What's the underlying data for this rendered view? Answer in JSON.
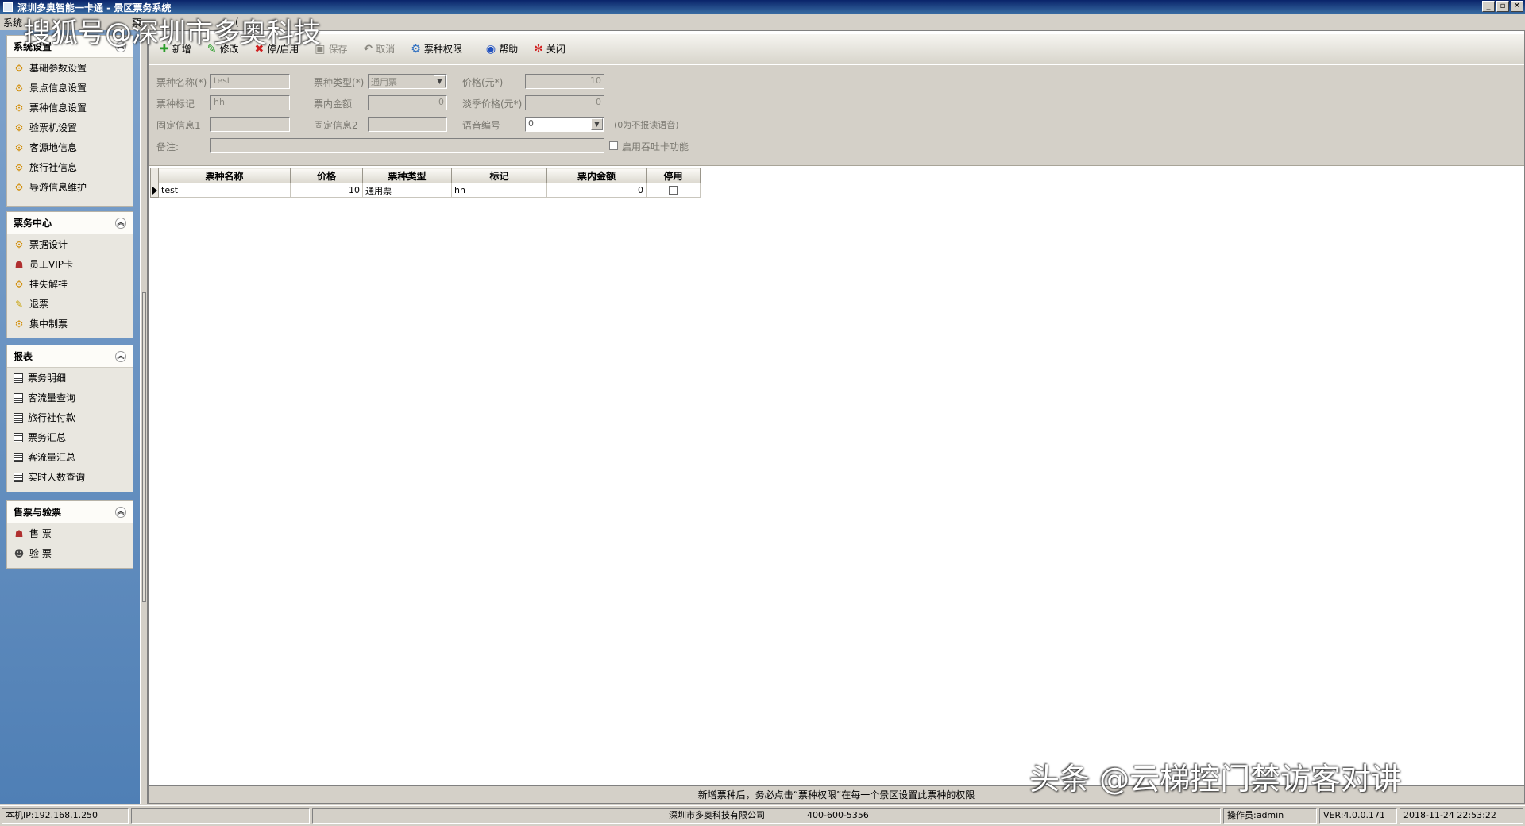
{
  "window": {
    "title": "深圳多奥智能一卡通 - 景区票务系统",
    "buttons": [
      "_",
      "▫",
      "✕"
    ]
  },
  "watermarks": {
    "top": "搜狐号@深圳市多奥科技",
    "bottom": "头条 @云梯控门禁访客对讲"
  },
  "menu": {
    "items": [
      "系统",
      "",
      "票",
      "",
      "(",
      ""
    ]
  },
  "sidebar": {
    "sections": [
      {
        "title": "系统设置",
        "items": [
          "基础参数设置",
          "景点信息设置",
          "票种信息设置",
          "验票机设置",
          "客源地信息",
          "旅行社信息",
          "导游信息维护"
        ]
      },
      {
        "title": "票务中心",
        "items": [
          "票据设计",
          "员工VIP卡",
          "挂失解挂",
          "退票",
          "集中制票"
        ]
      },
      {
        "title": "报表",
        "items": [
          "票务明细",
          "客流量查询",
          "旅行社付款",
          "票务汇总",
          "客流量汇总",
          "实时人数查询"
        ]
      },
      {
        "title": "售票与验票",
        "items": [
          "售 票",
          "验 票"
        ]
      }
    ]
  },
  "toolbar": {
    "add": "新增",
    "edit": "修改",
    "stop_enable": "停/启用",
    "save": "保存",
    "cancel": "取消",
    "permission": "票种权限",
    "help": "帮助",
    "close": "关闭"
  },
  "form": {
    "ticket_name_label": "票种名称(*)",
    "ticket_name_value": "test",
    "ticket_type_label": "票种类型(*)",
    "ticket_type_value": "通用票",
    "price_label": "价格(元*)",
    "price_value": "10",
    "ticket_mark_label": "票种标记",
    "ticket_mark_value": "hh",
    "inner_amount_label": "票内金额",
    "inner_amount_value": "0",
    "offseason_price_label": "淡季价格(元*)",
    "offseason_price_value": "0",
    "fixed_info1_label": "固定信息1",
    "fixed_info1_value": "",
    "fixed_info2_label": "固定信息2",
    "fixed_info2_value": "",
    "voice_no_label": "语音编号",
    "voice_no_value": "0",
    "voice_hint": "(0为不报读语音)",
    "remark_label": "备注:",
    "remark_value": "",
    "swallow_card_label": "启用吞吐卡功能"
  },
  "grid": {
    "columns": [
      "票种名称",
      "价格",
      "票种类型",
      "标记",
      "票内金额",
      "停用"
    ],
    "rows": [
      {
        "name": "test",
        "price": "10",
        "type": "通用票",
        "mark": "hh",
        "amount": "0",
        "disabled": false
      }
    ]
  },
  "hint": "新增票种后，务必点击“票种权限”在每一个景区设置此票种的权限",
  "statusbar": {
    "local_ip": "本机IP:192.168.1.250",
    "company": "深圳市多奥科技有限公司",
    "phone": "400-600-5356",
    "operator": "操作员:admin",
    "version": "VER:4.0.0.171",
    "datetime": "2018-11-24 22:53:22"
  },
  "colors": {
    "sidebar_top": "#7fa3cc",
    "sidebar_bottom": "#4f7fb5",
    "chrome": "#d4d0c8",
    "titlebar": "#0a246a"
  }
}
